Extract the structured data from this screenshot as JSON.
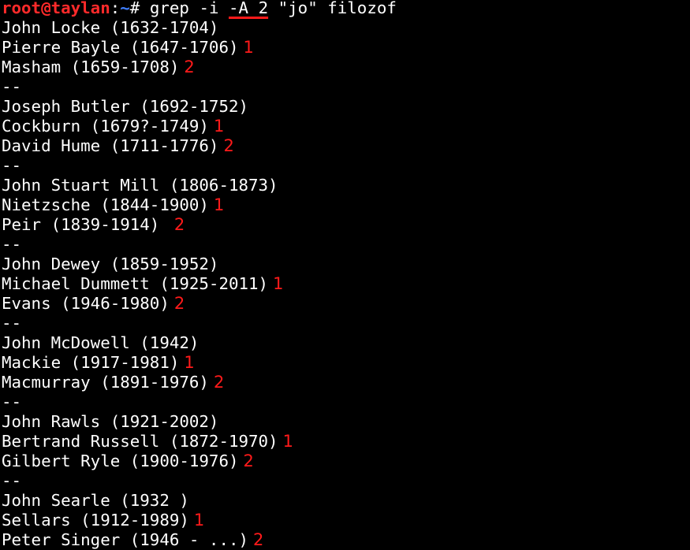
{
  "prompt": {
    "user_host": "root@taylan",
    "colon": ":",
    "path": "~",
    "symbol": "# ",
    "cmd_a": "grep -i ",
    "cmd_flag": "-A 2",
    "cmd_b": " \"jo\" filozof"
  },
  "lines": [
    {
      "text": "John Locke (1632-1704)",
      "annot": ""
    },
    {
      "text": "Pierre Bayle (1647-1706)",
      "annot": "1"
    },
    {
      "text": "Masham (1659-1708)",
      "annot": "2"
    },
    {
      "text": "--",
      "annot": ""
    },
    {
      "text": "Joseph Butler (1692-1752)",
      "annot": ""
    },
    {
      "text": "Cockburn (1679?-1749)",
      "annot": "1"
    },
    {
      "text": "David Hume (1711-1776)",
      "annot": "2"
    },
    {
      "text": "--",
      "annot": ""
    },
    {
      "text": "John Stuart Mill (1806-1873)",
      "annot": ""
    },
    {
      "text": "Nietzsche (1844-1900)",
      "annot": "1"
    },
    {
      "text": "Peir (1839-1914) ",
      "annot": "2"
    },
    {
      "text": "--",
      "annot": ""
    },
    {
      "text": "John Dewey (1859-1952)",
      "annot": ""
    },
    {
      "text": "Michael Dummett (1925-2011)",
      "annot": "1"
    },
    {
      "text": "Evans (1946-1980)",
      "annot": "2"
    },
    {
      "text": "--",
      "annot": ""
    },
    {
      "text": "John McDowell (1942)",
      "annot": ""
    },
    {
      "text": "Mackie (1917-1981)",
      "annot": "1"
    },
    {
      "text": "Macmurray (1891-1976)",
      "annot": "2"
    },
    {
      "text": "--",
      "annot": ""
    },
    {
      "text": "John Rawls (1921-2002)",
      "annot": ""
    },
    {
      "text": "Bertrand Russell (1872-1970)",
      "annot": "1"
    },
    {
      "text": "Gilbert Ryle (1900-1976)",
      "annot": "2"
    },
    {
      "text": "--",
      "annot": ""
    },
    {
      "text": "John Searle (1932 )",
      "annot": ""
    },
    {
      "text": "Sellars (1912-1989)",
      "annot": "1"
    },
    {
      "text": "Peter Singer (1946 - ...)",
      "annot": "2"
    }
  ],
  "colors": {
    "background": "#000000",
    "text": "#ffffff",
    "prompt_user": "#ff2a2a",
    "prompt_path": "#3f7fff",
    "annotation": "#ff1a1a"
  }
}
